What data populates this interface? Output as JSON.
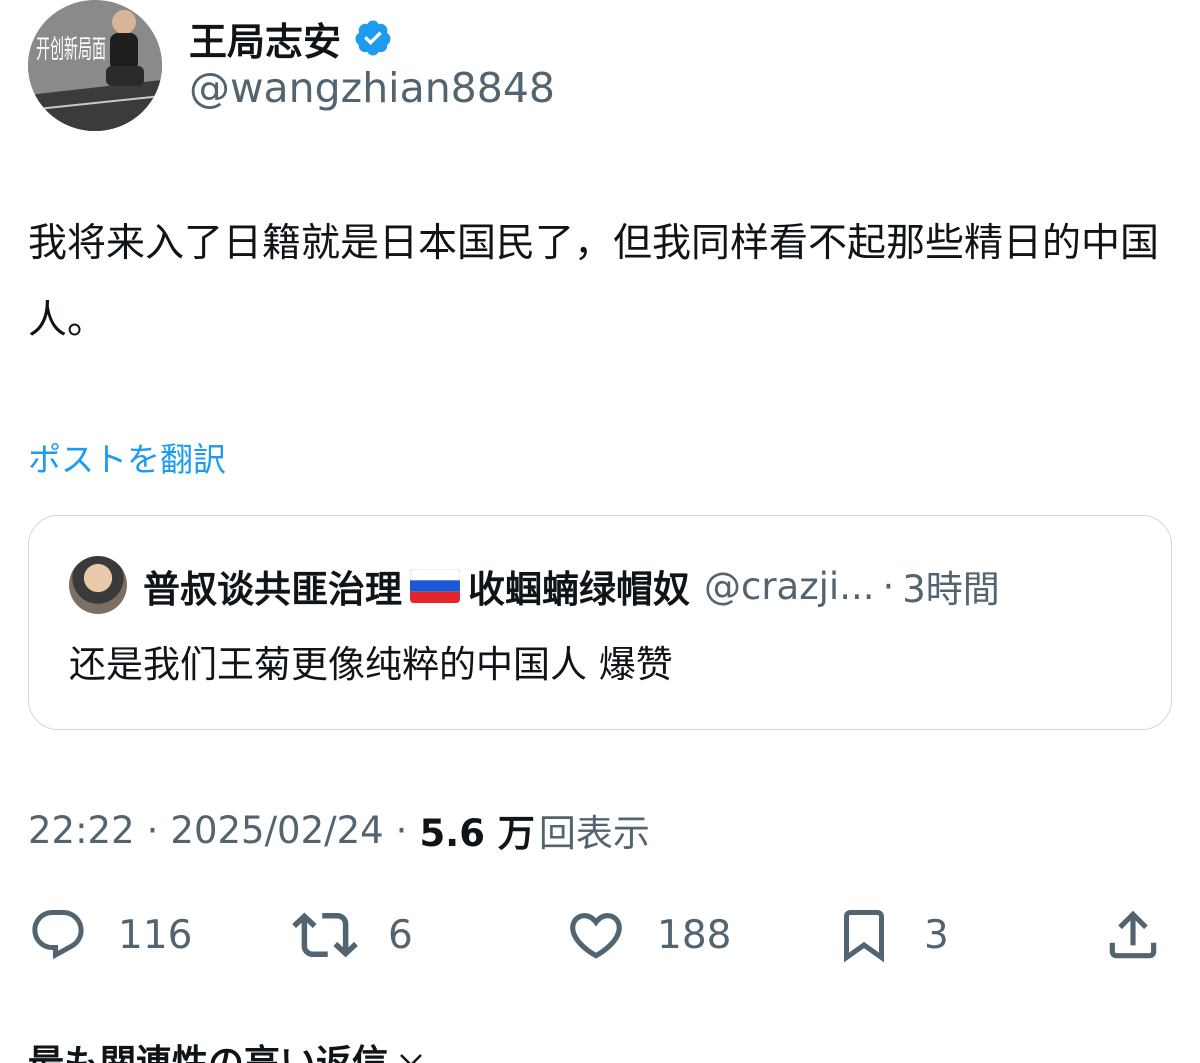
{
  "author": {
    "display_name": "王局志安",
    "handle": "@wangzhian8848",
    "verified_icon": "verified-badge-icon",
    "avatar_caption": "开创新局面"
  },
  "post": {
    "text": "我将来入了日籍就是日本国民了，但我同样看不起那些精日的中国人。",
    "translate_label": "ポストを翻訳"
  },
  "quote": {
    "name_before_flag": "普叔谈共匪治理",
    "flag_icon": "russia-flag-icon",
    "name_after_flag": "收蝈蝻绿帽奴",
    "handle": "@crazji...",
    "dot": "·",
    "time": "3時間",
    "text": "还是我们王菊更像纯粹的中国人  爆赞"
  },
  "meta": {
    "time": "22:22",
    "sep1": "·",
    "date": "2025/02/24",
    "sep2": "·",
    "views_count": "5.6 万",
    "views_label": "回表示"
  },
  "actions": {
    "replies": "116",
    "reposts": "6",
    "likes": "188",
    "bookmarks": "3"
  },
  "footer": {
    "sort_label": "最も関連性の高い返信",
    "chevron_icon": "chevron-down-icon"
  },
  "colors": {
    "text_primary": "#0f1419",
    "text_secondary": "#536471",
    "link_blue": "#1d9bf0",
    "border": "#cfd9de"
  }
}
